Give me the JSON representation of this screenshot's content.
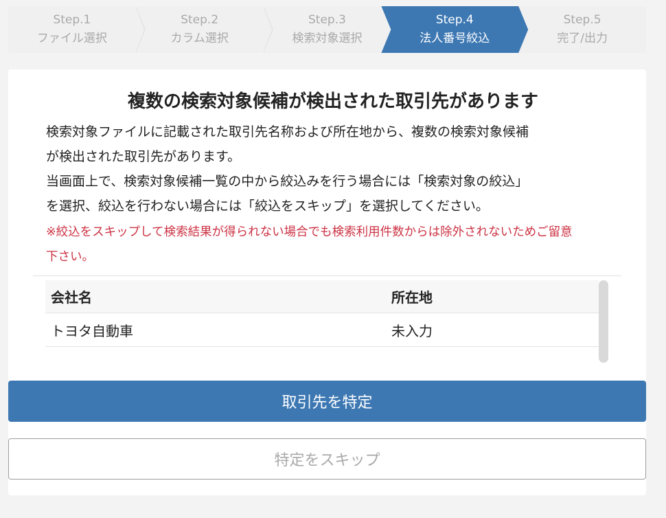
{
  "stepper": {
    "steps": [
      {
        "num": "Step.1",
        "label": "ファイル選択"
      },
      {
        "num": "Step.2",
        "label": "カラム選択"
      },
      {
        "num": "Step.3",
        "label": "検索対象選択"
      },
      {
        "num": "Step.4",
        "label": "法人番号絞込"
      },
      {
        "num": "Step.5",
        "label": "完了/出力"
      }
    ],
    "active_index": 3
  },
  "dialog": {
    "title": "複数の検索対象候補が検出された取引先があります",
    "desc_line1": "検索対象ファイルに記載された取引先名称および所在地から、複数の検索対象候補",
    "desc_line2": "が検出された取引先があります。",
    "desc_line3": "当画面上で、検索対象候補一覧の中から絞込みを行う場合には「検索対象の絞込」",
    "desc_line4": "を選択、絞込を行わない場合には「絞込をスキップ」を選択してください。",
    "warn_line1": "※絞込をスキップして検索結果が得られない場合でも検索利用件数からは除外されないためご留意",
    "warn_line2": "下さい。"
  },
  "table": {
    "columns": [
      "会社名",
      "所在地"
    ],
    "rows": [
      [
        "トヨタ自動車",
        "未入力"
      ]
    ]
  },
  "buttons": {
    "primary_label": "取引先を特定",
    "secondary_label": "特定をスキップ"
  },
  "colors": {
    "accent": "#3d78b3",
    "warning": "#cc3344"
  }
}
